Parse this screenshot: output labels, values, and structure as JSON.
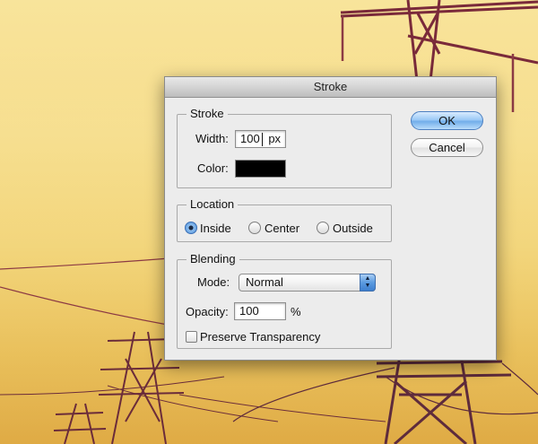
{
  "background": {
    "description_colors": {
      "sky_top": "#f2d67e",
      "sky_bottom": "#e3b04a",
      "tower": "#7a2a3a"
    }
  },
  "dialog": {
    "title": "Stroke",
    "stroke_group": {
      "legend": "Stroke",
      "width_label": "Width:",
      "width_value": "100",
      "width_unit": "px",
      "color_label": "Color:",
      "color_value": "#000000"
    },
    "location_group": {
      "legend": "Location",
      "options": [
        {
          "label": "Inside",
          "selected": true
        },
        {
          "label": "Center",
          "selected": false
        },
        {
          "label": "Outside",
          "selected": false
        }
      ]
    },
    "blending_group": {
      "legend": "Blending",
      "mode_label": "Mode:",
      "mode_value": "Normal",
      "opacity_label": "Opacity:",
      "opacity_value": "100",
      "opacity_unit": "%",
      "preserve_label": "Preserve Transparency",
      "preserve_checked": false
    },
    "buttons": {
      "ok": "OK",
      "cancel": "Cancel"
    },
    "colors": {
      "accent": "#5b9be0"
    }
  }
}
